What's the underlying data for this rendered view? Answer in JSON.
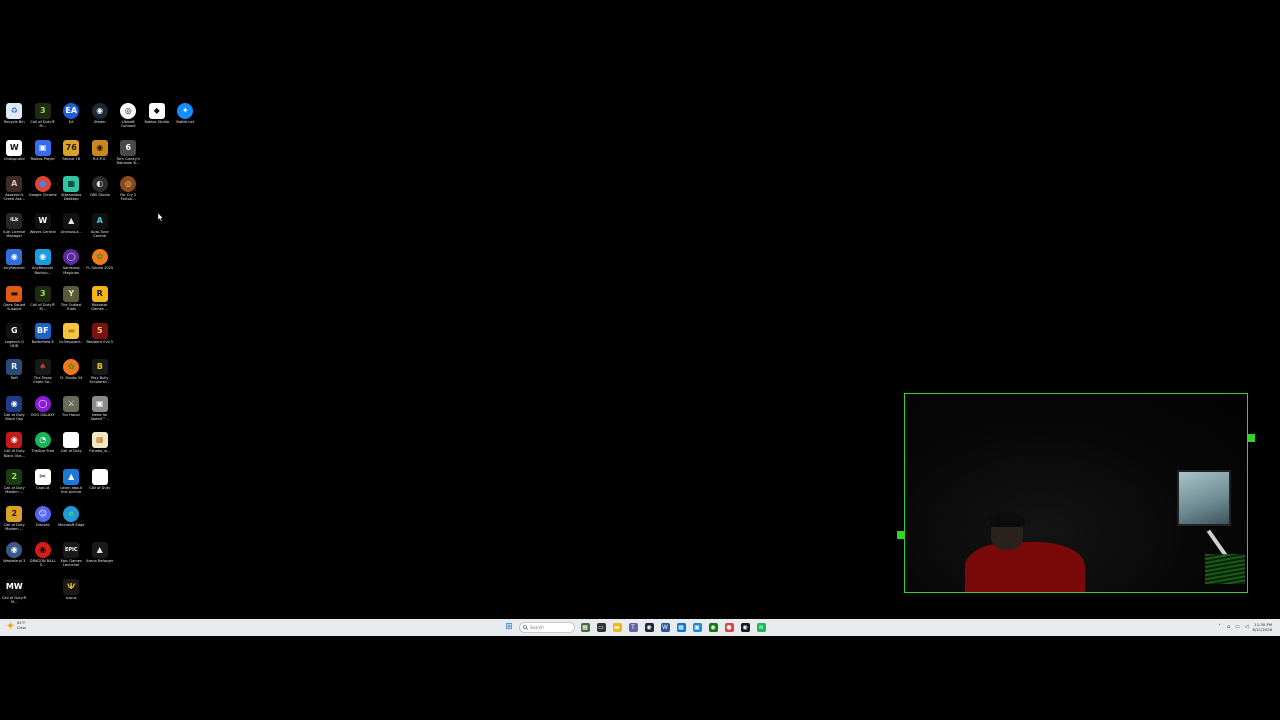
{
  "desktop": {
    "icons": [
      {
        "label": "Recycle Bin",
        "icon": "recycle-bin-icon",
        "glyph": "♻",
        "color": "#dfe9f3",
        "fg": "#2c74c9"
      },
      {
        "label": "Call of Duty® M...",
        "icon": "call-of-duty-mw3-icon",
        "glyph": "3",
        "color": "#1e2a14",
        "fg": "#9be04a"
      },
      {
        "label": "EA",
        "icon": "ea-app-icon",
        "glyph": "EA",
        "color": "#1f5fd6",
        "fg": "#ffffff",
        "round": true
      },
      {
        "label": "Steam",
        "icon": "steam-icon",
        "glyph": "◉",
        "color": "#1b2838",
        "fg": "#ffffff",
        "round": true
      },
      {
        "label": "Ubisoft Connect",
        "icon": "ubisoft-connect-icon",
        "glyph": "◎",
        "color": "#ffffff",
        "fg": "#111111",
        "round": true
      },
      {
        "label": "Roblox Studio",
        "icon": "roblox-studio-icon",
        "glyph": "◆",
        "color": "#ffffff",
        "fg": "#111111"
      },
      {
        "label": "Battle.net",
        "icon": "battlenet-icon",
        "glyph": "✦",
        "color": "#148eff",
        "fg": "#ffffff",
        "round": true
      },
      {
        "label": "Undisputed",
        "icon": "undisputed-icon",
        "glyph": "W",
        "color": "#ffffff",
        "fg": "#111111"
      },
      {
        "label": "Roblox Player",
        "icon": "roblox-player-icon",
        "glyph": "▣",
        "color": "#3a6cf0",
        "fg": "#ffffff"
      },
      {
        "label": "Fallout 76",
        "icon": "fallout-76-icon",
        "glyph": "76",
        "color": "#d8a12a",
        "fg": "#2a2000"
      },
      {
        "label": "R.E.P.O.",
        "icon": "repo-icon",
        "glyph": "◉",
        "color": "#c88a1e",
        "fg": "#2b1a00"
      },
      {
        "label": "Tom Clancy's Rainbow Si...",
        "icon": "rainbow-six-siege-icon",
        "glyph": "6",
        "color": "#4a4a4a",
        "fg": "#ffffff"
      },
      {
        "label": "",
        "icon": "",
        "glyph": "",
        "color": "",
        "fg": "",
        "empty": true
      },
      {
        "label": "",
        "icon": "",
        "glyph": "",
        "color": "",
        "fg": "",
        "empty": true
      },
      {
        "label": "Assassin's Creed Ass...",
        "icon": "assassins-creed-icon",
        "glyph": "A",
        "color": "#3b2b2b",
        "fg": "#e3c7a0"
      },
      {
        "label": "Google Chrome",
        "icon": "google-chrome-icon",
        "glyph": "●",
        "color": "#db4437",
        "fg": "#4285f4",
        "round": true
      },
      {
        "label": "Streamlabs Desktop",
        "icon": "streamlabs-icon",
        "glyph": "▦",
        "color": "#31c3a2",
        "fg": "#0b1e1a"
      },
      {
        "label": "OBS Studio",
        "icon": "obs-studio-icon",
        "glyph": "◐",
        "color": "#2c2c2c",
        "fg": "#e0e0e0",
        "round": true
      },
      {
        "label": "Far Cry 2 Fortun...",
        "icon": "far-cry-2-icon",
        "glyph": "◎",
        "color": "#8a4a1e",
        "fg": "#f3c48a",
        "round": true
      },
      {
        "label": "",
        "icon": "",
        "glyph": "",
        "color": "",
        "fg": "",
        "empty": true
      },
      {
        "label": "",
        "icon": "",
        "glyph": "",
        "color": "",
        "fg": "",
        "empty": true
      },
      {
        "label": "iLok License Manager",
        "icon": "ilok-icon",
        "glyph": "iLk",
        "color": "#262626",
        "fg": "#ffffff"
      },
      {
        "label": "Waves Central",
        "icon": "waves-central-icon",
        "glyph": "W",
        "color": "#111111",
        "fg": "#ffffff"
      },
      {
        "label": "AnimusLa...",
        "icon": "animus-icon",
        "glyph": "▲",
        "color": "#111111",
        "fg": "#e8e8e8"
      },
      {
        "label": "Auto-Tune Central",
        "icon": "auto-tune-icon",
        "glyph": "A",
        "color": "#111111",
        "fg": "#3fd0c8"
      },
      {
        "label": "",
        "icon": "",
        "glyph": "",
        "color": "",
        "fg": "",
        "empty": true
      },
      {
        "label": "",
        "icon": "",
        "glyph": "",
        "color": "",
        "fg": "",
        "empty": true
      },
      {
        "label": "",
        "icon": "",
        "glyph": "",
        "color": "",
        "fg": "",
        "empty": true
      },
      {
        "label": "AnyRecover",
        "icon": "anyrecover-icon",
        "glyph": "◉",
        "color": "#2f6fd8",
        "fg": "#ffffff"
      },
      {
        "label": "AnyRecover Backup...",
        "icon": "anyrecover-backup-icon",
        "glyph": "◉",
        "color": "#1e9ae0",
        "fg": "#ffffff"
      },
      {
        "label": "Samsung Magician",
        "icon": "samsung-magician-icon",
        "glyph": "◯",
        "color": "#5b2a9b",
        "fg": "#e8d9ff",
        "round": true
      },
      {
        "label": "FL Studio 2025",
        "icon": "fl-studio-icon",
        "glyph": "✿",
        "color": "#f07a1a",
        "fg": "#3a8f2a",
        "round": true
      },
      {
        "label": "",
        "icon": "",
        "glyph": "",
        "color": "",
        "fg": "",
        "empty": true
      },
      {
        "label": "",
        "icon": "",
        "glyph": "",
        "color": "",
        "fg": "",
        "empty": true
      },
      {
        "label": "",
        "icon": "",
        "glyph": "",
        "color": "",
        "fg": "",
        "empty": true
      },
      {
        "label": "Geek Squad Support",
        "icon": "geek-squad-icon",
        "glyph": "▬",
        "color": "#e05a12",
        "fg": "#111111"
      },
      {
        "label": "Call of Duty® M...",
        "icon": "call-of-duty-mw3-icon",
        "glyph": "3",
        "color": "#1e2a14",
        "fg": "#9be04a"
      },
      {
        "label": "The Outlast Trials",
        "icon": "outlast-trials-icon",
        "glyph": "Y",
        "color": "#5a5a3a",
        "fg": "#e0e0c0"
      },
      {
        "label": "Rockstar Games ...",
        "icon": "rockstar-games-icon",
        "glyph": "R",
        "color": "#f2b51a",
        "fg": "#111111"
      },
      {
        "label": "",
        "icon": "",
        "glyph": "",
        "color": "",
        "fg": "",
        "empty": true
      },
      {
        "label": "",
        "icon": "",
        "glyph": "",
        "color": "",
        "fg": "",
        "empty": true
      },
      {
        "label": "",
        "icon": "",
        "glyph": "",
        "color": "",
        "fg": "",
        "empty": true
      },
      {
        "label": "Logitech G HUB",
        "icon": "logitech-ghub-icon",
        "glyph": "G",
        "color": "#111111",
        "fg": "#ffffff"
      },
      {
        "label": "Battlefield 6",
        "icon": "battlefield-6-icon",
        "glyph": "BF",
        "color": "#1e63c8",
        "fg": "#ffffff"
      },
      {
        "label": "hc3mpparti...",
        "icon": "folder-icon",
        "glyph": "▬",
        "color": "#f5c542",
        "fg": "#b58a12"
      },
      {
        "label": "Resident Evil 5",
        "icon": "resident-evil-5-icon",
        "glyph": "5",
        "color": "#7a1212",
        "fg": "#f0d080"
      },
      {
        "label": "",
        "icon": "",
        "glyph": "",
        "color": "",
        "fg": "",
        "empty": true
      },
      {
        "label": "",
        "icon": "",
        "glyph": "",
        "color": "",
        "fg": "",
        "empty": true
      },
      {
        "label": "",
        "icon": "",
        "glyph": "",
        "color": "",
        "fg": "",
        "empty": true
      },
      {
        "label": "Raft",
        "icon": "raft-icon",
        "glyph": "R",
        "color": "#2a4a7a",
        "fg": "#e0eaff"
      },
      {
        "label": "The Texas Chain Sa...",
        "icon": "texas-chain-saw-icon",
        "glyph": "♠",
        "color": "#1a1a1a",
        "fg": "#c04040"
      },
      {
        "label": "FL Studio 24",
        "icon": "fl-studio-icon",
        "glyph": "✿",
        "color": "#f07a1a",
        "fg": "#3a8f2a",
        "round": true
      },
      {
        "label": "Play Bully Scholarsh...",
        "icon": "bully-icon",
        "glyph": "B",
        "color": "#1a1a1a",
        "fg": "#f2c21a"
      },
      {
        "label": "",
        "icon": "",
        "glyph": "",
        "color": "",
        "fg": "",
        "empty": true
      },
      {
        "label": "",
        "icon": "",
        "glyph": "",
        "color": "",
        "fg": "",
        "empty": true
      },
      {
        "label": "",
        "icon": "",
        "glyph": "",
        "color": "",
        "fg": "",
        "empty": true
      },
      {
        "label": "Call of Duty Black Ops",
        "icon": "call-of-duty-black-ops-icon",
        "glyph": "◉",
        "color": "#1e3a8a",
        "fg": "#ffffff"
      },
      {
        "label": "GOG GALAXY",
        "icon": "gog-galaxy-icon",
        "glyph": "◯",
        "color": "#8a1ad8",
        "fg": "#ffffff",
        "round": true
      },
      {
        "label": "For Honor",
        "icon": "for-honor-icon",
        "glyph": "⚔",
        "color": "#6a6a5a",
        "fg": "#f0f0e0"
      },
      {
        "label": "Need for Speed™...",
        "icon": "need-for-speed-icon",
        "glyph": "▣",
        "color": "#8a8a8a",
        "fg": "#ffffff"
      },
      {
        "label": "",
        "icon": "",
        "glyph": "",
        "color": "",
        "fg": "",
        "empty": true
      },
      {
        "label": "",
        "icon": "",
        "glyph": "",
        "color": "",
        "fg": "",
        "empty": true
      },
      {
        "label": "",
        "icon": "",
        "glyph": "",
        "color": "",
        "fg": "",
        "empty": true
      },
      {
        "label": "Call of Duty Black Ops...",
        "icon": "call-of-duty-black-ops-icon",
        "glyph": "◉",
        "color": "#c01a1a",
        "fg": "#ffffff"
      },
      {
        "label": "TheSize Free",
        "icon": "thesize-icon",
        "glyph": "◔",
        "color": "#1ab35a",
        "fg": "#ffffff",
        "round": true
      },
      {
        "label": "Call of Duty",
        "icon": "file-icon",
        "glyph": "",
        "color": "#ffffff",
        "fg": "#111111"
      },
      {
        "label": "Fstudio_w...",
        "icon": "fl-studio-installer-icon",
        "glyph": "▦",
        "color": "#f0e6c8",
        "fg": "#c07a1a"
      },
      {
        "label": "",
        "icon": "",
        "glyph": "",
        "color": "",
        "fg": "",
        "empty": true
      },
      {
        "label": "",
        "icon": "",
        "glyph": "",
        "color": "",
        "fg": "",
        "empty": true
      },
      {
        "label": "",
        "icon": "",
        "glyph": "",
        "color": "",
        "fg": "",
        "empty": true
      },
      {
        "label": "Call of Duty Modern ...",
        "icon": "call-of-duty-mw2-icon",
        "glyph": "2",
        "color": "#1e3a14",
        "fg": "#9be04a"
      },
      {
        "label": "CapCut",
        "icon": "capcut-icon",
        "glyph": "✂",
        "color": "#ffffff",
        "fg": "#111111"
      },
      {
        "label": "Learn about this picture",
        "icon": "spotlight-icon",
        "glyph": "▲",
        "color": "#1a78d8",
        "fg": "#ffffff"
      },
      {
        "label": "Call of Duty",
        "icon": "file-icon",
        "glyph": "",
        "color": "#ffffff",
        "fg": "#111111"
      },
      {
        "label": "",
        "icon": "",
        "glyph": "",
        "color": "",
        "fg": "",
        "empty": true
      },
      {
        "label": "",
        "icon": "",
        "glyph": "",
        "color": "",
        "fg": "",
        "empty": true
      },
      {
        "label": "",
        "icon": "",
        "glyph": "",
        "color": "",
        "fg": "",
        "empty": true
      },
      {
        "label": "Call of Duty Modern ...",
        "icon": "call-of-duty-mw2-icon",
        "glyph": "2",
        "color": "#d8a12a",
        "fg": "#2a1a00"
      },
      {
        "label": "Discord",
        "icon": "discord-icon",
        "glyph": "☺",
        "color": "#5865f2",
        "fg": "#ffffff",
        "round": true
      },
      {
        "label": "Microsoft Edge",
        "icon": "microsoft-edge-icon",
        "glyph": "e",
        "color": "#1e9ad8",
        "fg": "#3fd07a",
        "round": true
      },
      {
        "label": "",
        "icon": "",
        "glyph": "",
        "color": "",
        "fg": "",
        "empty": true
      },
      {
        "label": "",
        "icon": "",
        "glyph": "",
        "color": "",
        "fg": "",
        "empty": true
      },
      {
        "label": "",
        "icon": "",
        "glyph": "",
        "color": "",
        "fg": "",
        "empty": true
      },
      {
        "label": "",
        "icon": "",
        "glyph": "",
        "color": "",
        "fg": "",
        "empty": true
      },
      {
        "label": "Wasteland 3",
        "icon": "wasteland-3-icon",
        "glyph": "◉",
        "color": "#3a5a8a",
        "fg": "#ffffff",
        "round": true
      },
      {
        "label": "DRAGON BALL S...",
        "icon": "dragon-ball-icon",
        "glyph": "◉",
        "color": "#d81a1a",
        "fg": "#111111",
        "round": true
      },
      {
        "label": "Epic Games Launcher",
        "icon": "epic-games-icon",
        "glyph": "EPIC",
        "color": "#1a1a1a",
        "fg": "#ffffff"
      },
      {
        "label": "Arena Reforger",
        "icon": "arma-reforger-icon",
        "glyph": "▲",
        "color": "#1a1a1a",
        "fg": "#e0e0e0"
      },
      {
        "label": "",
        "icon": "",
        "glyph": "",
        "color": "",
        "fg": "",
        "empty": true
      },
      {
        "label": "",
        "icon": "",
        "glyph": "",
        "color": "",
        "fg": "",
        "empty": true
      },
      {
        "label": "",
        "icon": "",
        "glyph": "",
        "color": "",
        "fg": "",
        "empty": true
      },
      {
        "label": "Call of Duty® M...",
        "icon": "call-of-duty-mw-icon",
        "glyph": "MW",
        "color": "#111111",
        "fg": "#ffffff"
      },
      {
        "label": "",
        "icon": "",
        "glyph": "",
        "color": "",
        "fg": "",
        "empty": true
      },
      {
        "label": "Icarus",
        "icon": "icarus-icon",
        "glyph": "Ѱ",
        "color": "#1a1a1a",
        "fg": "#e8b81a"
      },
      {
        "label": "",
        "icon": "",
        "glyph": "",
        "color": "",
        "fg": "",
        "empty": true
      }
    ]
  },
  "taskbar": {
    "weather": {
      "temp": "84°F",
      "condition": "Clear"
    },
    "search": {
      "placeholder": "Search"
    },
    "pinned": [
      {
        "icon": "windows-start-icon",
        "glyph": "⊞",
        "color": "#1a78d8"
      },
      {
        "icon": "search-icon",
        "glyph": "",
        "color": ""
      },
      {
        "icon": "widgets-icon",
        "glyph": "▦",
        "color": "#4a6a3a"
      },
      {
        "icon": "task-view-icon",
        "glyph": "▭",
        "color": "#333333"
      },
      {
        "icon": "file-explorer-icon",
        "glyph": "▬",
        "color": "#f2b51a"
      },
      {
        "icon": "teams-icon",
        "glyph": "T",
        "color": "#6264a7"
      },
      {
        "icon": "steam-icon",
        "glyph": "◉",
        "color": "#1b2838"
      },
      {
        "icon": "word-icon",
        "glyph": "W",
        "color": "#2b579a"
      },
      {
        "icon": "store-icon",
        "glyph": "▦",
        "color": "#0078d4"
      },
      {
        "icon": "photos-icon",
        "glyph": "▣",
        "color": "#1a8ad8"
      },
      {
        "icon": "xbox-icon",
        "glyph": "◉",
        "color": "#107c10"
      },
      {
        "icon": "google-chrome-icon",
        "glyph": "●",
        "color": "#db4437"
      },
      {
        "icon": "steam-icon",
        "glyph": "◉",
        "color": "#171a21"
      },
      {
        "icon": "spotify-icon",
        "glyph": "≋",
        "color": "#1db954"
      }
    ],
    "clock": {
      "time": "11:30 PM",
      "date": "8/21/2026"
    }
  },
  "colors": {
    "desktop_background": "#000000",
    "taskbar": "#e9ecef",
    "webcam_border": "#35d22a"
  }
}
